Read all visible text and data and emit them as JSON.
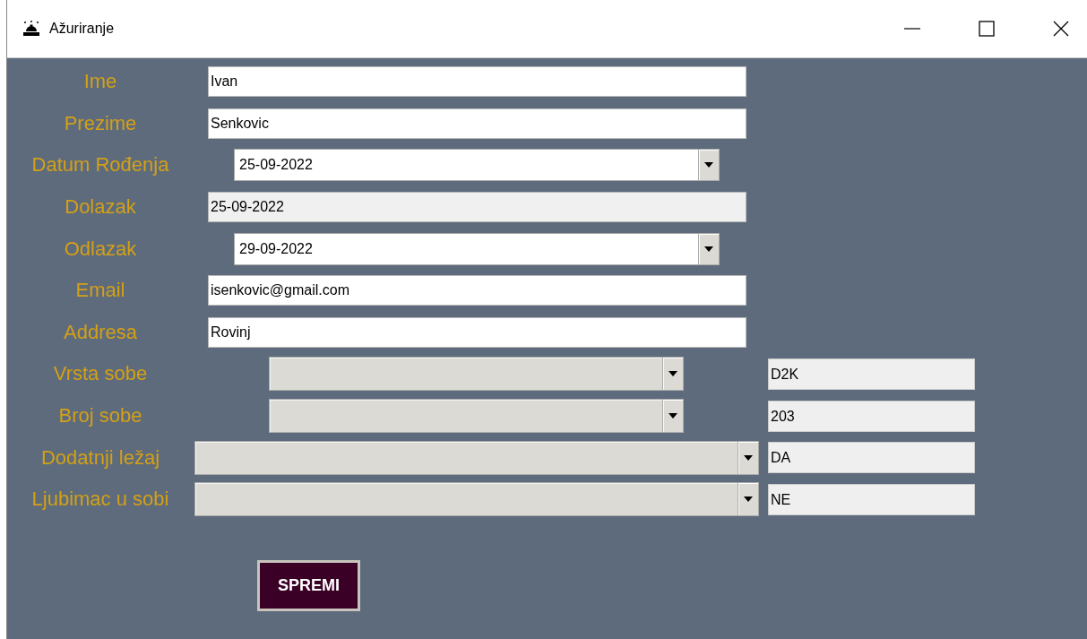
{
  "window": {
    "title": "Ažuriranje"
  },
  "fields": [
    {
      "kind": "entry",
      "label": "Ime",
      "value": "Ivan",
      "disabled": false
    },
    {
      "kind": "entry",
      "label": "Prezime",
      "value": "Senkovic",
      "disabled": false
    },
    {
      "kind": "date",
      "label": "Datum Rođenja",
      "value": "25-09-2022"
    },
    {
      "kind": "entry",
      "label": "Dolazak",
      "value": "25-09-2022",
      "disabled": true
    },
    {
      "kind": "date",
      "label": "Odlazak",
      "value": "29-09-2022"
    },
    {
      "kind": "entry",
      "label": "Email",
      "value": "isenkovic@gmail.com",
      "disabled": false
    },
    {
      "kind": "entry",
      "label": "Addresa",
      "value": "Rovinj",
      "disabled": false
    },
    {
      "kind": "combo",
      "label": "Vrsta sobe",
      "side_value": "D2K"
    },
    {
      "kind": "combo",
      "label": "Broj sobe",
      "side_value": "203"
    },
    {
      "kind": "longcombo",
      "label": "Dodatnji ležaj",
      "side_value": "DA"
    },
    {
      "kind": "longcombo",
      "label": "Ljubimac u sobi",
      "side_value": "NE"
    }
  ],
  "save_button": "SPREMI"
}
